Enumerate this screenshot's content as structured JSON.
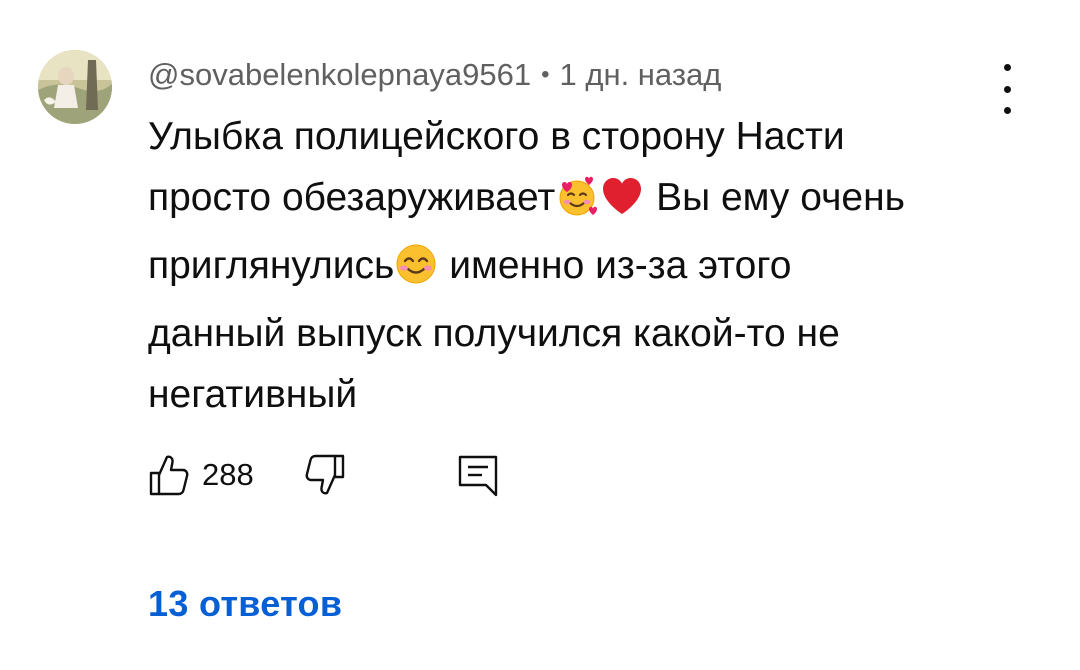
{
  "comment": {
    "author": "@sovabelenkolepnaya9561",
    "separator": "•",
    "time": "1 дн. назад",
    "lines": [
      "Улыбка полицейского в сторону Насти",
      "просто обезаруживает",
      "Вы ему очень",
      "приглянулись",
      "именно из-за этого",
      "данный выпуск получился какой-то не",
      "негативный"
    ],
    "emojis": [
      "smiling-face-with-hearts",
      "red-heart",
      "smiling-face-with-smiling-eyes"
    ],
    "actions": {
      "like_count": "288",
      "like_icon": "thumb-up-icon",
      "dislike_icon": "thumb-down-icon",
      "reply_icon": "reply-comment-icon"
    },
    "replies_label": "13 ответов"
  },
  "colors": {
    "text": "#0f0f0f",
    "meta": "#606060",
    "link": "#065fd4",
    "background": "#ffffff"
  }
}
